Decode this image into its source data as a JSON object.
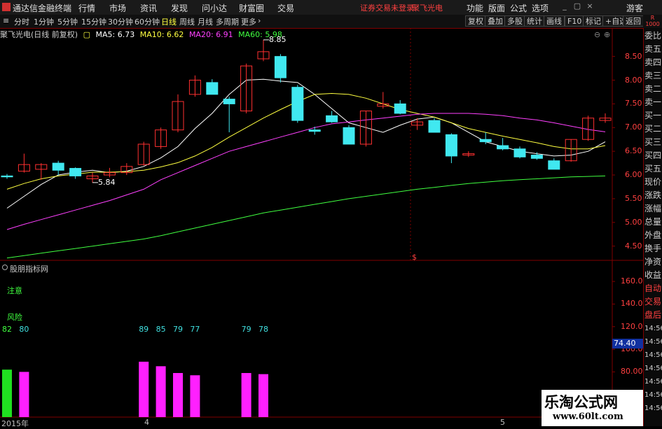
{
  "app": {
    "title": "通达信金融终端",
    "menu": [
      "行情",
      "市场",
      "资讯",
      "发现",
      "问小达",
      "财富圈",
      "交易"
    ],
    "alert": "证券交易未登录",
    "stock_short": "聚飞光电",
    "right_menu": [
      "功能",
      "版面",
      "公式",
      "选项"
    ],
    "guest": "游客",
    "corner_text": [
      "R",
      "1000"
    ]
  },
  "periods": {
    "items": [
      "分时",
      "1分钟",
      "5分钟",
      "15分钟",
      "30分钟",
      "60分钟",
      "日线",
      "周线",
      "月线",
      "多周期",
      "更多"
    ],
    "active": "日线"
  },
  "tools": [
    "复权",
    "叠加",
    "多股",
    "统计",
    "画线",
    "F10",
    "标记",
    "+自选",
    "返回"
  ],
  "info": {
    "stock": "聚飞光电(日线 前复权)",
    "ma5": "MA5: 6.73",
    "ma10": "MA10: 6.62",
    "ma20": "MA20: 6.91",
    "ma60": "MA60: 5.98",
    "colors": {
      "ma5": "#ffffff",
      "ma10": "#ffff40",
      "ma20": "#ff40ff",
      "ma60": "#40ff40"
    }
  },
  "sidebar": [
    "委比",
    "卖五",
    "卖四",
    "卖三",
    "卖二",
    "卖一",
    "买一",
    "买二",
    "买三",
    "买四",
    "买五",
    "现价",
    "涨跌",
    "涨幅",
    "总量",
    "外盘",
    "换手",
    "净资",
    "收益",
    "自动",
    "交易",
    "盘后",
    "14:56",
    "14:56",
    "14:56",
    "14:56",
    "14:56",
    "14:56",
    "14:56"
  ],
  "sub_panel": {
    "title": "股朋指标网",
    "note_label": "注意",
    "risk_label": "风险",
    "current_value": "74.40",
    "y_ticks": [
      "160.00",
      "140.00",
      "120.00",
      "100.00",
      "80.00",
      "60.00"
    ]
  },
  "x_ticks": [
    "2015年",
    "4",
    "5"
  ],
  "marker_char": "$",
  "watermark": {
    "main": "乐淘公式网",
    "url": "www.60lt.com"
  },
  "chart_data": [
    {
      "type": "candlestick",
      "title": "",
      "ylim": [
        4.2,
        9.1
      ],
      "y_ticks": [
        4.5,
        5.0,
        5.5,
        6.0,
        6.5,
        7.0,
        7.5,
        8.0,
        8.5
      ],
      "annotations": [
        {
          "text": "8.85",
          "value": 8.85,
          "index": 15
        },
        {
          "text": "5.84",
          "value": 5.84,
          "index": 5
        }
      ],
      "candles": [
        {
          "o": 5.98,
          "h": 6.02,
          "l": 5.92,
          "c": 5.96
        },
        {
          "o": 6.08,
          "h": 6.45,
          "l": 6.05,
          "c": 6.22
        },
        {
          "o": 6.12,
          "h": 6.25,
          "l": 5.9,
          "c": 6.22
        },
        {
          "o": 6.25,
          "h": 6.3,
          "l": 6.0,
          "c": 6.1
        },
        {
          "o": 6.14,
          "h": 6.16,
          "l": 5.92,
          "c": 5.98
        },
        {
          "o": 5.92,
          "h": 6.05,
          "l": 5.84,
          "c": 5.98
        },
        {
          "o": 6.0,
          "h": 6.15,
          "l": 5.95,
          "c": 6.05
        },
        {
          "o": 6.05,
          "h": 6.25,
          "l": 6.0,
          "c": 6.18
        },
        {
          "o": 6.22,
          "h": 6.7,
          "l": 6.2,
          "c": 6.65
        },
        {
          "o": 6.6,
          "h": 7.0,
          "l": 6.55,
          "c": 6.95
        },
        {
          "o": 6.95,
          "h": 7.7,
          "l": 6.9,
          "c": 7.55
        },
        {
          "o": 7.7,
          "h": 8.1,
          "l": 7.65,
          "c": 8.0
        },
        {
          "o": 7.95,
          "h": 8.02,
          "l": 7.7,
          "c": 7.7
        },
        {
          "o": 7.6,
          "h": 7.65,
          "l": 6.9,
          "c": 7.5
        },
        {
          "o": 7.35,
          "h": 8.35,
          "l": 7.3,
          "c": 8.3
        },
        {
          "o": 8.45,
          "h": 8.85,
          "l": 8.4,
          "c": 8.6
        },
        {
          "o": 8.5,
          "h": 8.55,
          "l": 7.95,
          "c": 8.05
        },
        {
          "o": 7.85,
          "h": 7.9,
          "l": 7.1,
          "c": 7.15
        },
        {
          "o": 6.95,
          "h": 7.02,
          "l": 6.85,
          "c": 6.92
        },
        {
          "o": 7.25,
          "h": 7.35,
          "l": 7.1,
          "c": 7.12
        },
        {
          "o": 7.0,
          "h": 7.05,
          "l": 6.65,
          "c": 6.65
        },
        {
          "o": 6.65,
          "h": 7.35,
          "l": 6.6,
          "c": 7.35
        },
        {
          "o": 7.45,
          "h": 7.75,
          "l": 7.4,
          "c": 7.5
        },
        {
          "o": 7.5,
          "h": 7.58,
          "l": 7.28,
          "c": 7.3
        },
        {
          "o": 7.05,
          "h": 7.2,
          "l": 6.95,
          "c": 7.12
        },
        {
          "o": 7.15,
          "h": 7.2,
          "l": 6.9,
          "c": 6.9
        },
        {
          "o": 6.85,
          "h": 6.88,
          "l": 6.25,
          "c": 6.4
        },
        {
          "o": 6.42,
          "h": 6.5,
          "l": 6.38,
          "c": 6.45
        },
        {
          "o": 6.75,
          "h": 6.9,
          "l": 6.65,
          "c": 6.7
        },
        {
          "o": 6.62,
          "h": 6.78,
          "l": 6.52,
          "c": 6.55
        },
        {
          "o": 6.55,
          "h": 6.6,
          "l": 6.35,
          "c": 6.38
        },
        {
          "o": 6.42,
          "h": 6.48,
          "l": 6.32,
          "c": 6.35
        },
        {
          "o": 6.3,
          "h": 6.35,
          "l": 6.12,
          "c": 6.12
        },
        {
          "o": 6.3,
          "h": 6.75,
          "l": 6.28,
          "c": 6.75
        },
        {
          "o": 6.75,
          "h": 7.25,
          "l": 6.72,
          "c": 7.2
        },
        {
          "o": 7.15,
          "h": 7.3,
          "l": 7.1,
          "c": 7.2
        }
      ],
      "series": [
        {
          "key": "ma5",
          "color": "#ffffff",
          "values": [
            5.3,
            5.55,
            5.8,
            6.0,
            6.06,
            6.1,
            6.05,
            6.08,
            6.18,
            6.36,
            6.6,
            6.98,
            7.3,
            7.7,
            8.0,
            8.02,
            7.98,
            7.95,
            7.7,
            7.4,
            7.1,
            7.0,
            6.9,
            7.05,
            7.18,
            7.22,
            7.1,
            6.9,
            6.7,
            6.6,
            6.5,
            6.45,
            6.4,
            6.42,
            6.5,
            6.7
          ]
        },
        {
          "key": "ma10",
          "color": "#ffff40",
          "values": [
            5.7,
            5.82,
            5.92,
            5.98,
            6.02,
            6.06,
            6.06,
            6.07,
            6.1,
            6.17,
            6.26,
            6.4,
            6.58,
            6.8,
            7.0,
            7.2,
            7.38,
            7.55,
            7.7,
            7.72,
            7.7,
            7.62,
            7.5,
            7.38,
            7.3,
            7.22,
            7.1,
            6.98,
            6.9,
            6.82,
            6.75,
            6.68,
            6.6,
            6.55,
            6.55,
            6.62
          ]
        },
        {
          "key": "ma20",
          "color": "#ff40ff",
          "values": [
            4.85,
            4.96,
            5.06,
            5.16,
            5.26,
            5.36,
            5.46,
            5.58,
            5.7,
            5.9,
            6.05,
            6.2,
            6.35,
            6.5,
            6.6,
            6.7,
            6.8,
            6.9,
            7.0,
            7.08,
            7.12,
            7.16,
            7.2,
            7.24,
            7.28,
            7.3,
            7.3,
            7.3,
            7.28,
            7.25,
            7.2,
            7.16,
            7.1,
            7.03,
            6.96,
            6.91
          ]
        },
        {
          "key": "ma60",
          "color": "#40ff40",
          "values": [
            4.25,
            4.3,
            4.35,
            4.4,
            4.45,
            4.5,
            4.55,
            4.6,
            4.65,
            4.72,
            4.8,
            4.88,
            4.96,
            5.04,
            5.12,
            5.2,
            5.26,
            5.32,
            5.38,
            5.44,
            5.5,
            5.55,
            5.6,
            5.65,
            5.7,
            5.74,
            5.78,
            5.82,
            5.85,
            5.88,
            5.9,
            5.92,
            5.94,
            5.96,
            5.97,
            5.98
          ]
        }
      ]
    },
    {
      "type": "bar",
      "title": "股朋指标网",
      "ylim": [
        40,
        170
      ],
      "y_ticks": [
        60,
        80,
        100,
        120,
        140,
        160
      ],
      "bars": [
        {
          "index": 0,
          "value": 82,
          "color": "#20e020"
        },
        {
          "index": 1,
          "value": 80,
          "color": "#ff20ff"
        },
        {
          "index": 8,
          "value": 89,
          "color": "#ff20ff"
        },
        {
          "index": 9,
          "value": 85,
          "color": "#ff20ff"
        },
        {
          "index": 10,
          "value": 79,
          "color": "#ff20ff"
        },
        {
          "index": 11,
          "value": 77,
          "color": "#ff20ff"
        },
        {
          "index": 14,
          "value": 79,
          "color": "#ff20ff"
        },
        {
          "index": 15,
          "value": 78,
          "color": "#ff20ff"
        }
      ],
      "bar_labels": [
        {
          "index": 0,
          "text": "82",
          "color": "#40ff40"
        },
        {
          "index": 1,
          "text": "80",
          "color": "#40e0e0"
        },
        {
          "index": 8,
          "text": "89",
          "color": "#40e0e0"
        },
        {
          "index": 9,
          "text": "85",
          "color": "#40e0e0"
        },
        {
          "index": 10,
          "text": "79",
          "color": "#40e0e0"
        },
        {
          "index": 11,
          "text": "77",
          "color": "#40e0e0"
        },
        {
          "index": 14,
          "text": "79",
          "color": "#40e0e0"
        },
        {
          "index": 15,
          "text": "78",
          "color": "#40e0e0"
        }
      ]
    }
  ]
}
